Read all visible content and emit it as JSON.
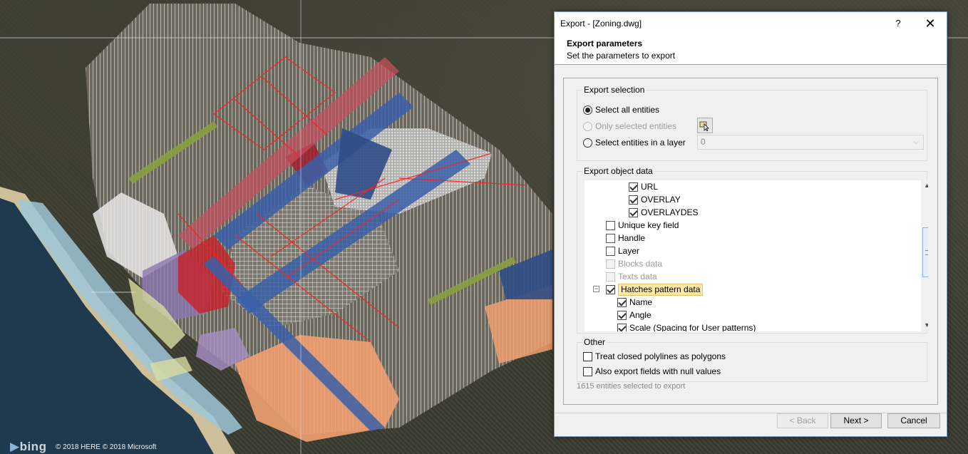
{
  "map": {
    "provider_logo": "bing",
    "copyright": "© 2018 HERE © 2018 Microsoft"
  },
  "dialog": {
    "title": "Export - [Zoning.dwg]",
    "help_label": "?",
    "close_label": "✕",
    "header": {
      "title": "Export parameters",
      "subtitle": "Set the parameters to export"
    },
    "export_selection": {
      "legend": "Export selection",
      "options": [
        {
          "label": "Select all entities",
          "selected": true,
          "enabled": true
        },
        {
          "label": "Only selected entities",
          "selected": false,
          "enabled": false
        },
        {
          "label": "Select entities in a layer",
          "selected": false,
          "enabled": true
        }
      ],
      "layer_value": "0"
    },
    "export_object_data": {
      "legend": "Export object data",
      "items": [
        {
          "label": "URL",
          "checked": true,
          "enabled": true,
          "level": 2
        },
        {
          "label": "OVERLAY",
          "checked": true,
          "enabled": true,
          "level": 2
        },
        {
          "label": "OVERLAYDES",
          "checked": true,
          "enabled": true,
          "level": 2
        },
        {
          "label": "Unique key field",
          "checked": false,
          "enabled": true,
          "level": 1
        },
        {
          "label": "Handle",
          "checked": false,
          "enabled": true,
          "level": 1
        },
        {
          "label": "Layer",
          "checked": false,
          "enabled": true,
          "level": 1
        },
        {
          "label": "Blocks data",
          "checked": false,
          "enabled": false,
          "level": 1
        },
        {
          "label": "Texts data",
          "checked": false,
          "enabled": false,
          "level": 1
        },
        {
          "label": "Hatches pattern data",
          "checked": true,
          "enabled": true,
          "level": 1,
          "highlighted": true,
          "expanded": true
        },
        {
          "label": "Name",
          "checked": true,
          "enabled": true,
          "level": 2
        },
        {
          "label": "Angle",
          "checked": true,
          "enabled": true,
          "level": 2
        },
        {
          "label": "Scale (Spacing for User patterns)",
          "checked": true,
          "enabled": true,
          "level": 2
        }
      ],
      "expander_label": "−"
    },
    "other": {
      "legend": "Other",
      "options": [
        {
          "label": "Treat closed polylines as polygons",
          "checked": false
        },
        {
          "label": "Also export fields with null values",
          "checked": false
        }
      ]
    },
    "status": "1615 entities selected to export",
    "buttons": {
      "back": "< Back",
      "next": "Next >",
      "cancel": "Cancel"
    },
    "scroll_up": "▲",
    "scroll_down": "▼",
    "combo_arrow": "⌵"
  },
  "colors": {
    "accent_border": "#7a98c2",
    "highlight_bg": "#ffe8a6",
    "zoning_red": "#c8202a",
    "zoning_blue": "#3a5fa8",
    "zoning_orange": "#f0a070",
    "ocean": "#1f3a4e",
    "beach": "#cdbf99"
  }
}
